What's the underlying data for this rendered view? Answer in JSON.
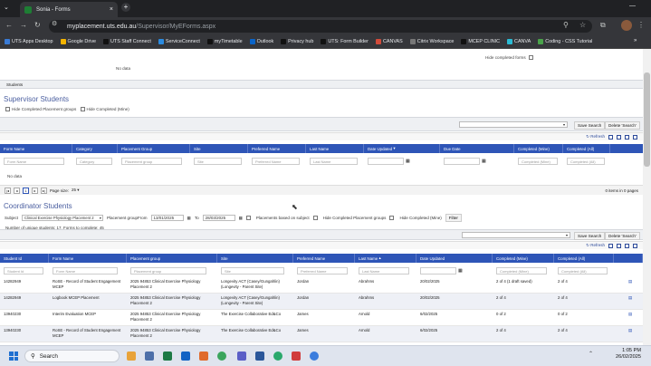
{
  "browser": {
    "tab_title": "Sonia - Forms",
    "url_host": "myplacement.uts.edu.au",
    "url_path": "/Supervisor/MyEForms.aspx",
    "bookmarks": [
      "UTS Apps Desktop",
      "Google Drive",
      "UTS Staff Connect",
      "ServiceConnect",
      "myTimetable",
      "Outlook",
      "Privacy hub",
      "UTS: Form Builder",
      "CANVAS",
      "Citrix Workspace",
      "MCEP CLINIC",
      "CANVA",
      "Coding - CSS Tutorial"
    ]
  },
  "top": {
    "no_data": "No data",
    "hide_completed": "Hide completed forms",
    "section_label": "Students"
  },
  "supervisor": {
    "title": "Supervisor Students",
    "hide_placement": "Hide Completed Placement groups",
    "hide_mine": "Hide Completed (Mine)",
    "save_search": "Save Search",
    "delete_search": "Delete 'Search'",
    "refresh": "Refresh",
    "columns": [
      "Form Name",
      "Category",
      "Placement Group",
      "Site",
      "Preferred Name",
      "Last Name",
      "Date Updated",
      "Due Date",
      "Completed (Mine)",
      "Completed (All)"
    ],
    "filters": [
      "Form Name",
      "Category",
      "Placement group",
      "Site",
      "Preferred Name",
      "Last Name",
      "",
      "",
      "Completed (Mine)",
      "Completed (All)"
    ],
    "no_data": "No data",
    "page_size_label": "Page size:",
    "page_size": "25",
    "page_current": "1",
    "items_info": "0 items in 0 pages"
  },
  "coordinator": {
    "title": "Coordinator Students",
    "subject_label": "Subject",
    "subject_value": "Clinical Exercise Physiology Placement 2",
    "pg_from_label": "Placement groupFrom",
    "from_date": "13/01/2025",
    "to_label": "To",
    "to_date": "28/03/2025",
    "placements_subject": "Placements based on subject",
    "hide_placement": "Hide Completed Placement groups",
    "hide_mine": "Hide Completed (Mine)",
    "filter_btn": "Filter",
    "summary": "Number of unique students: 17. Forms to complete: 45",
    "save_search": "Save Search",
    "delete_search": "Delete 'Search'",
    "refresh": "Refresh",
    "columns": [
      "Student Id",
      "Form Name",
      "Placement group",
      "Site",
      "Preferred Name",
      "Last Name",
      "Date Updated",
      "Completed (Mine)",
      "Completed (All)"
    ],
    "filters": [
      "Student Id",
      "Form Name",
      "Placement group",
      "Site",
      "Preferred Name",
      "Last Name",
      "",
      "Completed (Mine)",
      "Completed (All)"
    ],
    "rows": [
      {
        "id": "14282949",
        "form": "RoSE - Record of Student Engagement MCEP",
        "group": "2025 94853 Clinical Exercise Physiology Placement 2",
        "site": "Longevity ACT (Casey/Gungahlin) (Longevity - Parent Site)",
        "pref": "Jordan",
        "last": "Abrahms",
        "date": "20/02/2025",
        "mine": "2 of 4 (1 draft saved)",
        "all": "2 of 4"
      },
      {
        "id": "14282949",
        "form": "Logbook MCEP Placement",
        "group": "2025 94853 Clinical Exercise Physiology Placement 2",
        "site": "Longevity ACT (Casey/Gungahlin) (Longevity - Parent Site)",
        "pref": "Jordan",
        "last": "Abrahms",
        "date": "20/02/2025",
        "mine": "2 of 4",
        "all": "2 of 4"
      },
      {
        "id": "13940230",
        "form": "Interim Evaluation MCEP",
        "group": "2025 94853 Clinical Exercise Physiology Placement 2",
        "site": "The Exercise Collaborative Ed&Co",
        "pref": "James",
        "last": "Arnold",
        "date": "6/02/2025",
        "mine": "0 of 2",
        "all": "0 of 2"
      },
      {
        "id": "13940230",
        "form": "RoSE - Record of Student Engagement MCEP",
        "group": "2025 94853 Clinical Exercise Physiology Placement 2",
        "site": "The Exercise Collaborative Ed&Co",
        "pref": "James",
        "last": "Arnold",
        "date": "6/02/2025",
        "mine": "2 of 4",
        "all": "2 of 4"
      }
    ]
  },
  "taskbar": {
    "search": "Search",
    "time": "1:05 PM",
    "date": "26/02/2025"
  }
}
